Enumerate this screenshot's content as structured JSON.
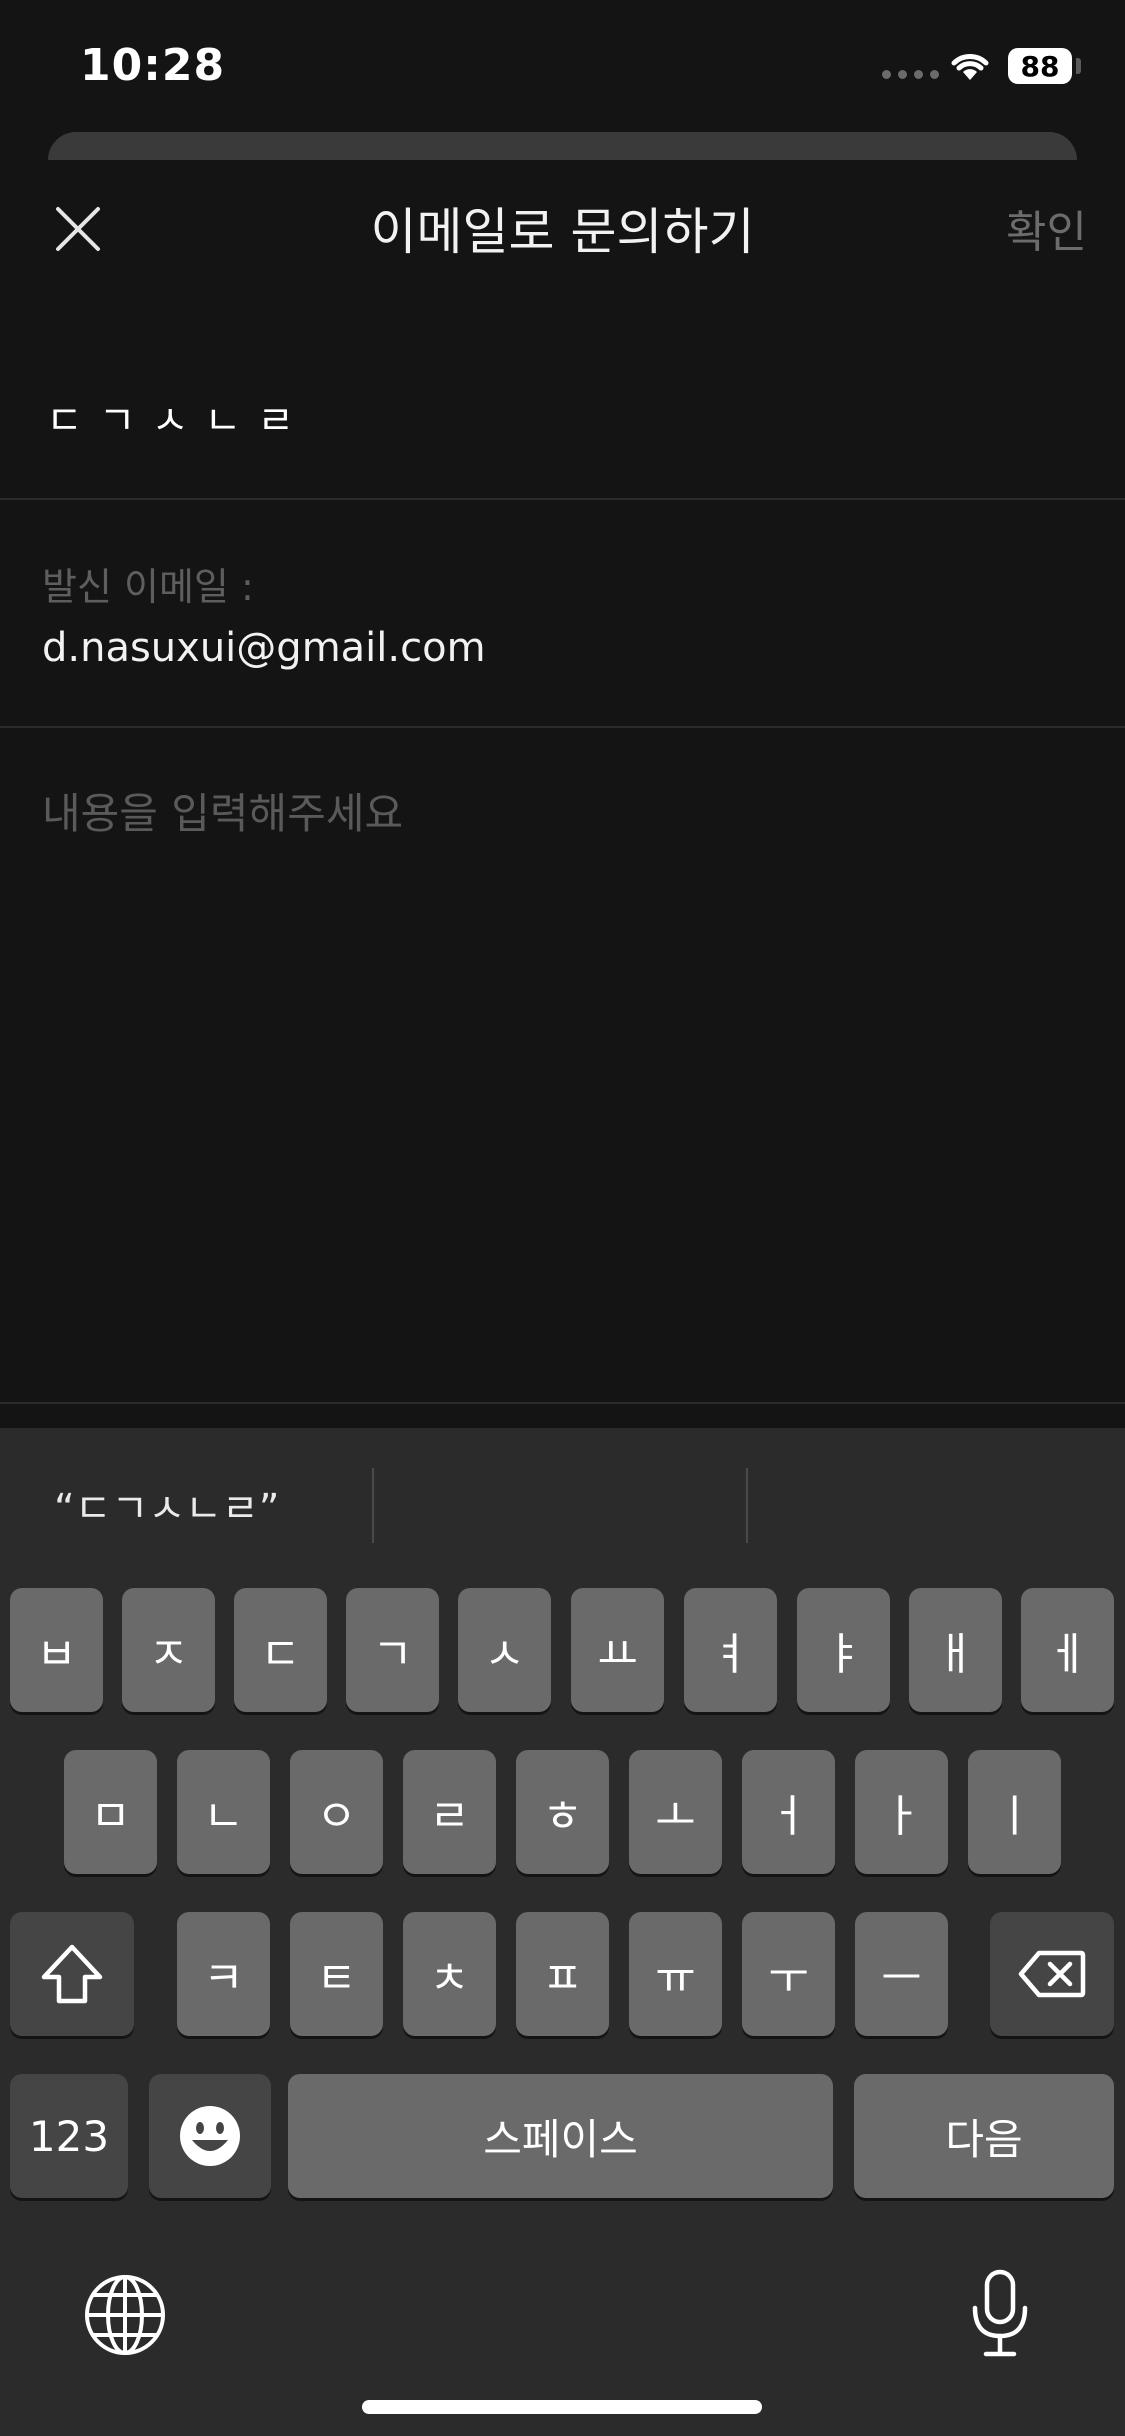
{
  "status_bar": {
    "time": "10:28",
    "battery": "88",
    "icons": [
      "signal-dots-icon",
      "wifi-icon",
      "battery-icon"
    ]
  },
  "header": {
    "close_icon": "close-icon",
    "title": "이메일로 문의하기",
    "confirm_label": "확인"
  },
  "form": {
    "subject_value": "ㄷㄱㅅㄴㄹ",
    "sender_label": "발신 이메일 :",
    "sender_email": "d.nasuxui@gmail.com",
    "body_placeholder": "내용을 입력해주세요"
  },
  "keyboard": {
    "suggestions": [
      "“ㄷㄱㅅㄴㄹ”",
      "",
      ""
    ],
    "row1": [
      "ㅂ",
      "ㅈ",
      "ㄷ",
      "ㄱ",
      "ㅅ",
      "ㅛ",
      "ㅕ",
      "ㅑ",
      "ㅐ",
      "ㅔ"
    ],
    "row2": [
      "ㅁ",
      "ㄴ",
      "ㅇ",
      "ㄹ",
      "ㅎ",
      "ㅗ",
      "ㅓ",
      "ㅏ",
      "ㅣ"
    ],
    "row3": [
      "ㅋ",
      "ㅌ",
      "ㅊ",
      "ㅍ",
      "ㅠ",
      "ㅜ",
      "ㅡ"
    ],
    "shift_icon": "shift-icon",
    "delete_icon": "delete-icon",
    "numbers_label": "123",
    "emoji_icon": "emoji-icon",
    "space_label": "스페이스",
    "next_label": "다음",
    "globe_icon": "globe-icon",
    "mic_icon": "microphone-icon"
  },
  "colors": {
    "background": "#141414",
    "keyboard_background": "#2b2b2b",
    "key": "#6a6a6a",
    "key_dark": "#454545",
    "muted_text": "#6c6c6c"
  }
}
